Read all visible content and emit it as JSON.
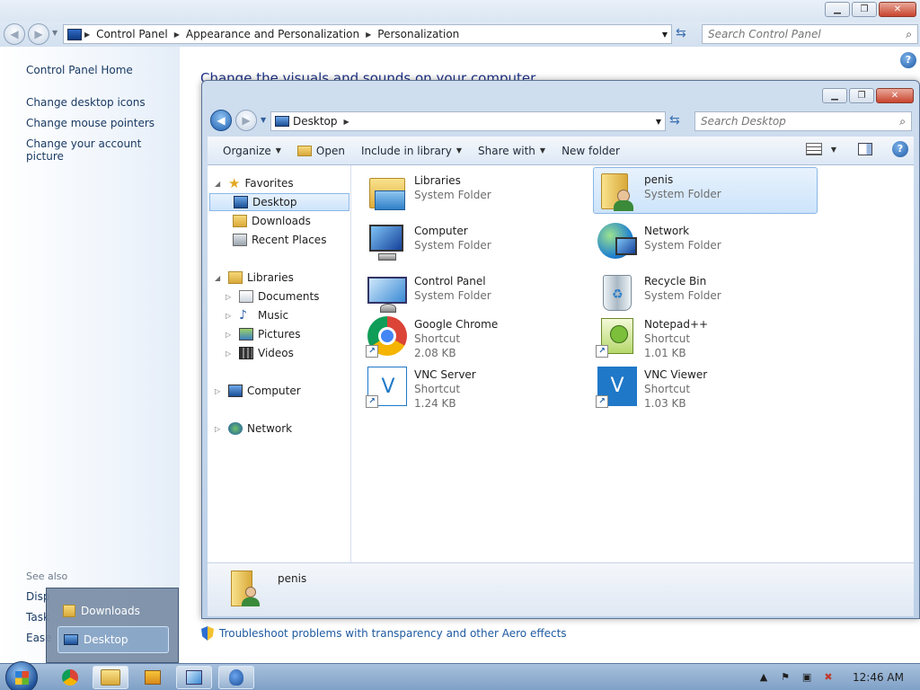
{
  "control_panel": {
    "breadcrumb": [
      "Control Panel",
      "Appearance and Personalization",
      "Personalization"
    ],
    "search_placeholder": "Search Control Panel",
    "left_links": [
      "Control Panel Home",
      "Change desktop icons",
      "Change mouse pointers",
      "Change your account picture"
    ],
    "see_also_label": "See also",
    "see_also_links": [
      "Disp",
      "Task",
      "Ease"
    ],
    "heading": "Change the visuals and sounds on your computer",
    "troubleshoot_link": "Troubleshoot problems with transparency and other Aero effects"
  },
  "explorer": {
    "location": "Desktop",
    "search_placeholder": "Search Desktop",
    "toolbar": {
      "organize": "Organize",
      "open": "Open",
      "include_in_library": "Include in library",
      "share_with": "Share with",
      "new_folder": "New folder"
    },
    "nav": {
      "favorites": "Favorites",
      "desktop": "Desktop",
      "downloads": "Downloads",
      "recent_places": "Recent Places",
      "libraries": "Libraries",
      "documents": "Documents",
      "music": "Music",
      "pictures": "Pictures",
      "videos": "Videos",
      "computer": "Computer",
      "network": "Network"
    },
    "items": [
      {
        "name": "Libraries",
        "type": "System Folder",
        "size": "",
        "icon": "libraries-icon"
      },
      {
        "name": "penis",
        "type": "System Folder",
        "size": "",
        "icon": "user-folder-icon"
      },
      {
        "name": "Computer",
        "type": "System Folder",
        "size": "",
        "icon": "computer-icon"
      },
      {
        "name": "Network",
        "type": "System Folder",
        "size": "",
        "icon": "network-icon"
      },
      {
        "name": "Control Panel",
        "type": "System Folder",
        "size": "",
        "icon": "control-panel-icon"
      },
      {
        "name": "Recycle Bin",
        "type": "System Folder",
        "size": "",
        "icon": "recycle-bin-icon"
      },
      {
        "name": "Google Chrome",
        "type": "Shortcut",
        "size": "2.08 KB",
        "icon": "chrome-icon"
      },
      {
        "name": "Notepad++",
        "type": "Shortcut",
        "size": "1.01 KB",
        "icon": "notepadpp-icon"
      },
      {
        "name": "VNC Server",
        "type": "Shortcut",
        "size": "1.24 KB",
        "icon": "vnc-icon"
      },
      {
        "name": "VNC Viewer",
        "type": "Shortcut",
        "size": "1.03 KB",
        "icon": "vnc-icon"
      }
    ],
    "details_name": "penis"
  },
  "jumplist": {
    "items": [
      "Downloads",
      "Desktop"
    ]
  },
  "taskbar": {
    "clock": "12:46 AM"
  },
  "colors": {
    "link_blue": "#1e5aa0",
    "heading_blue": "#1e3287",
    "selection_bg": "#cde4fb",
    "selection_border": "#8ab7e6"
  }
}
